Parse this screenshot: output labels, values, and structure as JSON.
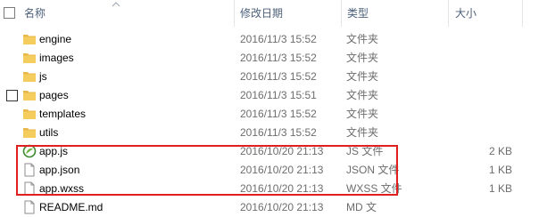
{
  "columns": {
    "name": "名称",
    "date": "修改日期",
    "type": "类型",
    "size": "大小"
  },
  "files": [
    {
      "name": "engine",
      "date": "2016/11/3 15:52",
      "type": "文件夹",
      "size": "",
      "icon": "folder-icon"
    },
    {
      "name": "images",
      "date": "2016/11/3 15:52",
      "type": "文件夹",
      "size": "",
      "icon": "folder-icon"
    },
    {
      "name": "js",
      "date": "2016/11/3 15:52",
      "type": "文件夹",
      "size": "",
      "icon": "folder-icon"
    },
    {
      "name": "pages",
      "date": "2016/11/3 15:51",
      "type": "文件夹",
      "size": "",
      "icon": "folder-icon"
    },
    {
      "name": "templates",
      "date": "2016/11/3 15:52",
      "type": "文件夹",
      "size": "",
      "icon": "folder-icon"
    },
    {
      "name": "utils",
      "date": "2016/11/3 15:52",
      "type": "文件夹",
      "size": "",
      "icon": "folder-icon"
    },
    {
      "name": "app.js",
      "date": "2016/10/20 21:13",
      "type": "JS 文件",
      "size": "2 KB",
      "icon": "js-file-icon"
    },
    {
      "name": "app.json",
      "date": "2016/10/20 21:13",
      "type": "JSON 文件",
      "size": "1 KB",
      "icon": "file-icon"
    },
    {
      "name": "app.wxss",
      "date": "2016/10/20 21:13",
      "type": "WXSS 文件",
      "size": "1 KB",
      "icon": "file-icon"
    },
    {
      "name": "README.md",
      "date": "2016/10/20 21:13",
      "type": "MD 文",
      "size": "",
      "icon": "file-icon"
    }
  ],
  "colors": {
    "header_text": "#4c607a",
    "highlight_border": "#e02020",
    "folder": "#e8b84a"
  }
}
